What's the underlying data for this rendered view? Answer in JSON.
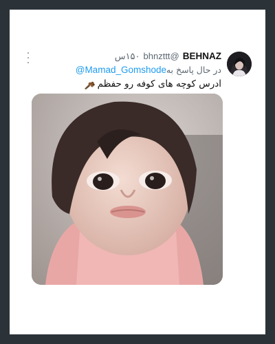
{
  "tweet": {
    "author_name": "BEHNAZ",
    "author_handle": "@bhnzttt",
    "timestamp": "۱۵۰س",
    "reply_prefix": "در حال پاسخ به",
    "reply_to": "@Mamad_Gomshode",
    "text": "ادرس کوچه های کوفه رو حفظم",
    "emoji_icon": "bouquet-icon",
    "menu_icon": "more-vertical-icon",
    "media_subject": "toddler-photo"
  },
  "colors": {
    "background": "#2b3338",
    "card": "#ffffff",
    "link": "#1d9bf0",
    "secondary_text": "#5b6670"
  }
}
